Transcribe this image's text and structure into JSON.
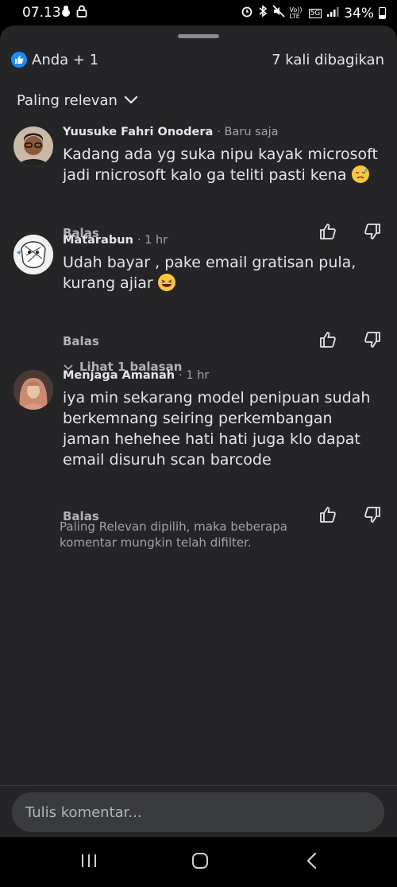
{
  "status_bar": {
    "time": "07.13",
    "battery": "34%",
    "network_5g": "5G",
    "volte": "Vo)) LTE"
  },
  "reactions": {
    "label": "Anda + 1",
    "shares": "7 kali dibagikan"
  },
  "sort": {
    "label": "Paling relevan"
  },
  "comments": [
    {
      "author": "Yuusuke Fahri Onodera",
      "time": "· Baru saja",
      "text": "Kadang ada yg suka nipu kayak microsoft jadi rnicrosoft kalo ga teliti pasti kena",
      "reply_label": "Balas"
    },
    {
      "author": "Matarabun",
      "time": "· 1 hr",
      "text": "Udah bayar , pake email gratisan pula, kurang ajiar",
      "reply_label": "Balas",
      "view_replies": "Lihat 1 balasan"
    },
    {
      "author": "Menjaga Amanah",
      "time": "· 1 hr",
      "text": "iya min sekarang model penipuan sudah berkemnang seiring perkembangan jaman hehehee hati hati juga klo dapat email disuruh scan barcode",
      "reply_label": "Balas"
    }
  ],
  "filter_note": "Paling Relevan dipilih, maka beberapa komentar mungkin telah difilter.",
  "composer": {
    "placeholder": "Tulis komentar..."
  },
  "colors": {
    "sheet_bg": "#252527",
    "accent_blue": "#1d8cf0",
    "text_primary": "#e4e6eb",
    "text_secondary": "#b0b3b8"
  }
}
